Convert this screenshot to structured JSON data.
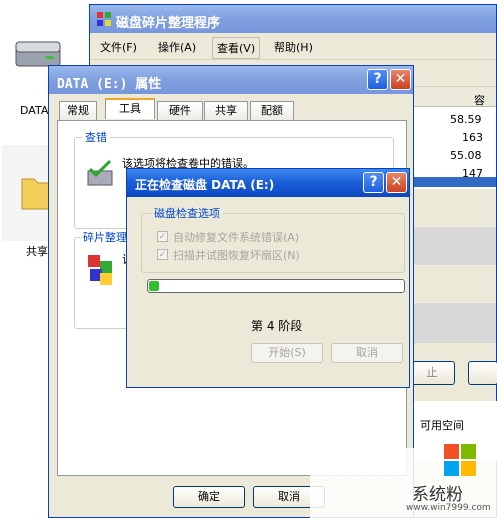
{
  "desktop": {
    "icon1_label": "DATA",
    "icon2_label": "共享"
  },
  "defrag": {
    "title": "磁盘碎片整理程序",
    "menu": [
      "文件(F)",
      "操作(A)",
      "查看(V)",
      "帮助(H)"
    ],
    "col_header": "容",
    "sizes": [
      "58.59",
      "163",
      "55.08",
      "147"
    ],
    "btn_stop_fragment": "止",
    "free_space_label": "可用空间"
  },
  "props": {
    "title": "DATA (E:) 属性",
    "tabs": [
      "常规",
      "工具",
      "硬件",
      "共享",
      "配额"
    ],
    "check_group_title": "查错",
    "check_desc": "该选项将检查卷中的错误。",
    "defrag_group_title": "碎片整理",
    "defrag_desc_fragment": "该",
    "ok": "确定",
    "cancel": "取消"
  },
  "check_dialog": {
    "title": "正在检查磁盘 DATA (E:)",
    "group_title": "磁盘检查选项",
    "option1": "自动修复文件系统错误(A)",
    "option2": "扫描并试图恢复坏扇区(N)",
    "progress": 0.04,
    "stage": "第 4 阶段",
    "start": "开始(S)",
    "cancel": "取消"
  },
  "watermark": {
    "brand": "系统粉",
    "url": "www.win7999.com"
  }
}
